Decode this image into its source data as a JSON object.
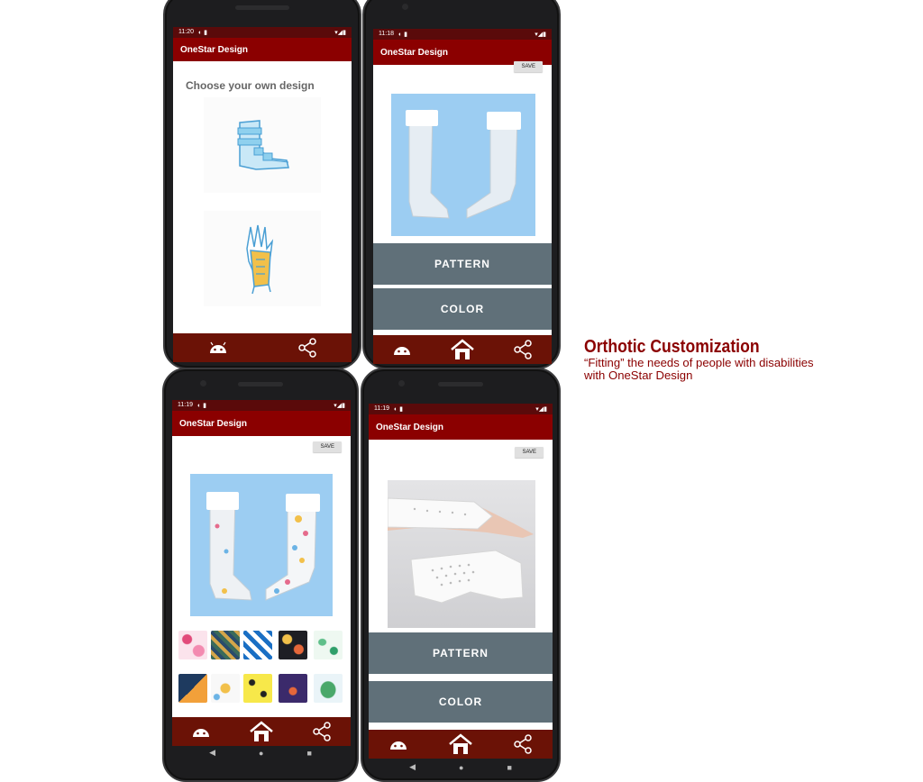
{
  "app": {
    "title": "OneStar Design"
  },
  "phone1": {
    "time": "11:20",
    "heading": "Choose your own design"
  },
  "phone2": {
    "time": "11:18",
    "save": "SAVE",
    "pattern": "PATTERN",
    "color": "COLOR"
  },
  "phone3": {
    "time": "11:19",
    "save": "SAVE"
  },
  "phone4": {
    "time": "11:19",
    "save": "SAVE",
    "pattern": "PATTERN",
    "color": "COLOR"
  },
  "caption": {
    "title": "Orthotic Customization",
    "line1": "“Fitting” the needs of people with disabilities",
    "line2": "with OneStar Design"
  },
  "colors": {
    "appbar": "#8b0000",
    "bottombar": "#6b1206",
    "button": "#607079",
    "photo_bg": "#9ccdf2"
  },
  "icons": [
    "android-icon",
    "home-icon",
    "share-icon",
    "back-icon",
    "home-circle-icon",
    "recents-icon"
  ]
}
